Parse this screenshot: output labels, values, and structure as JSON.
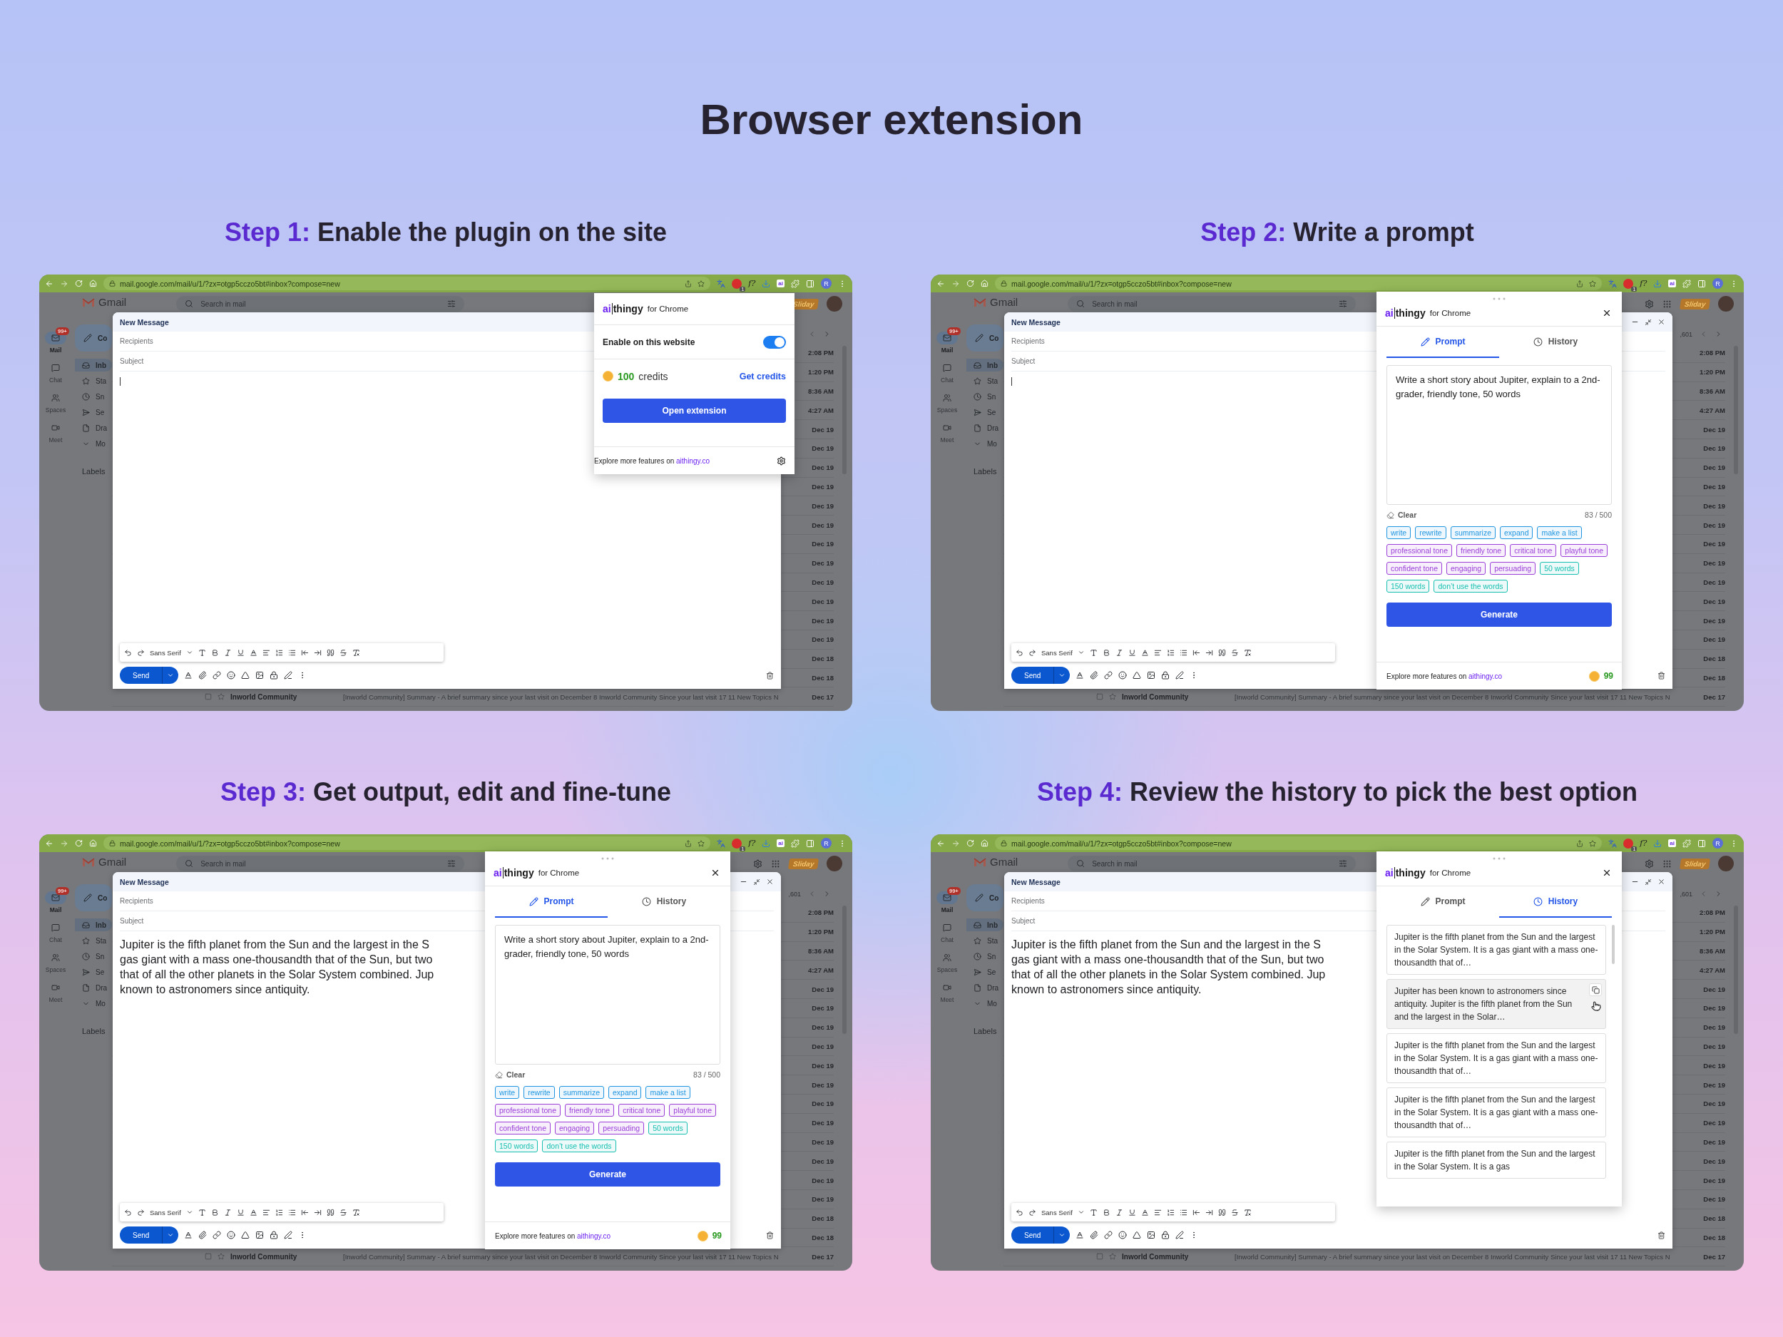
{
  "title": "Browser extension",
  "steps": [
    {
      "step": "Step 1:",
      "heading": "Enable the plugin on the site",
      "browser": {
        "url": "mail.google.com/mail/u/1/?zx=otgp5cczo5bt#inbox?compose=new",
        "ext_text": "f?",
        "ext_badge": "1",
        "ext_ai": "ai",
        "profile": "R"
      },
      "gmail": {
        "logo": "Gmail",
        "search": "Search in mail",
        "mail_badge": "99+",
        "badge": "Sliday",
        "compose_label": "Co",
        "labels": "Labels",
        "rail": [
          {
            "label": "Mail",
            "kind": "mail",
            "selected": true
          },
          {
            "label": "Chat",
            "kind": "chat",
            "selected": false
          },
          {
            "label": "Spaces",
            "kind": "spaces",
            "selected": false
          },
          {
            "label": "Meet",
            "kind": "meet",
            "selected": false
          }
        ],
        "nav": [
          {
            "label": "Inb",
            "kind": "inbox",
            "selected": true
          },
          {
            "label": "Sta",
            "kind": "star",
            "selected": false
          },
          {
            "label": "Sn",
            "kind": "clock",
            "selected": false
          },
          {
            "label": "Se",
            "kind": "send",
            "selected": false
          },
          {
            "label": "Dra",
            "kind": "file",
            "selected": false
          },
          {
            "label": "Mo",
            "kind": "more",
            "selected": false
          }
        ],
        "rows": [
          {
            "date": "2:08 PM"
          },
          {
            "date": "1:20 PM"
          },
          {
            "date": "8:36 AM"
          },
          {
            "date": "4:27 AM"
          },
          {
            "date": "Dec 19"
          },
          {
            "date": "Dec 19"
          },
          {
            "date": "Dec 19"
          },
          {
            "date": "Dec 19"
          },
          {
            "date": "Dec 19"
          },
          {
            "date": "Dec 19"
          },
          {
            "date": "Dec 19"
          },
          {
            "date": "Dec 19"
          },
          {
            "date": "Dec 19"
          },
          {
            "date": "Dec 19"
          },
          {
            "date": "Dec 19"
          },
          {
            "date": "Dec 19"
          },
          {
            "date": "Dec 18"
          },
          {
            "date": "Dec 18"
          },
          {
            "sender": "Inworld Community",
            "snippet": "[Inworld Community] Summary - A brief summary since your last visit on December 8 Inworld Community Since your last visit 17 11 New Topics N",
            "date": "Dec 17"
          }
        ]
      },
      "compose": {
        "title": "New Message",
        "recipients": "Recipients",
        "subject": "Subject",
        "font": "Sans Serif",
        "send": "Send"
      },
      "popup": {
        "kind": "quick",
        "logo_ai": "ai",
        "logo_name": "thingy",
        "logo_suffix": "for Chrome",
        "enable_label": "Enable on this website",
        "enabled": true,
        "credits_amount": "100",
        "credits_unit": "credits",
        "get_credits": "Get credits",
        "open_button": "Open extension",
        "footer_text": "Explore more features on",
        "footer_link": "aithingy.co"
      }
    },
    {
      "step": "Step 2:",
      "heading": "Write a prompt",
      "browser": {
        "url": "mail.google.com/mail/u/1/?zx=otgp5cczo5bt#inbox?compose=new",
        "ext_text": "f?",
        "ext_badge": "1",
        "ext_ai": "ai",
        "profile": "R"
      },
      "gmail": {
        "logo": "Gmail",
        "search": "Search in mail",
        "mail_badge": "99+",
        "badge": "Sliday",
        "pager_text": ",601",
        "compose_label": "Co",
        "labels": "Labels",
        "rail": [
          {
            "label": "Mail",
            "kind": "mail",
            "selected": true
          },
          {
            "label": "Chat",
            "kind": "chat",
            "selected": false
          },
          {
            "label": "Spaces",
            "kind": "spaces",
            "selected": false
          },
          {
            "label": "Meet",
            "kind": "meet",
            "selected": false
          }
        ],
        "nav": [
          {
            "label": "Inb",
            "kind": "inbox",
            "selected": true
          },
          {
            "label": "Sta",
            "kind": "star",
            "selected": false
          },
          {
            "label": "Sn",
            "kind": "clock",
            "selected": false
          },
          {
            "label": "Se",
            "kind": "send",
            "selected": false
          },
          {
            "label": "Dra",
            "kind": "file",
            "selected": false
          },
          {
            "label": "Mo",
            "kind": "more",
            "selected": false
          }
        ],
        "rows": [
          {
            "date": "2:08 PM"
          },
          {
            "date": "1:20 PM"
          },
          {
            "date": "8:36 AM"
          },
          {
            "date": "4:27 AM"
          },
          {
            "date": "Dec 19"
          },
          {
            "date": "Dec 19"
          },
          {
            "date": "Dec 19"
          },
          {
            "date": "Dec 19"
          },
          {
            "date": "Dec 19"
          },
          {
            "date": "Dec 19"
          },
          {
            "date": "Dec 19"
          },
          {
            "date": "Dec 19"
          },
          {
            "date": "Dec 19"
          },
          {
            "date": "Dec 19"
          },
          {
            "date": "Dec 19"
          },
          {
            "date": "Dec 19"
          },
          {
            "date": "Dec 18"
          },
          {
            "date": "Dec 18"
          },
          {
            "sender": "Inworld Community",
            "snippet": "[Inworld Community] Summary - A brief summary since your last visit on December 8 Inworld Community Since your last visit 17 11 New Topics N",
            "date": "Dec 17"
          }
        ]
      },
      "compose": {
        "title": "New Message",
        "recipients": "Recipients",
        "subject": "Subject",
        "font": "Sans Serif",
        "send": "Send"
      },
      "popup": {
        "kind": "prompt",
        "logo_ai": "ai",
        "logo_name": "thingy",
        "logo_suffix": "for Chrome",
        "tabs": [
          {
            "label": "Prompt",
            "kind": "edit",
            "selected": true
          },
          {
            "label": "History",
            "kind": "history",
            "selected": false
          }
        ],
        "prompt": "Write a short story about Jupiter, explain to a 2nd-grader, friendly tone, 50 words",
        "clear": "Clear",
        "counter": "83 / 500",
        "chips": [
          {
            "label": "write",
            "color": "#2196e0"
          },
          {
            "label": "rewrite",
            "color": "#2196e0"
          },
          {
            "label": "summarize",
            "color": "#2196e0"
          },
          {
            "label": "expand",
            "color": "#2196e0"
          },
          {
            "label": "make a list",
            "color": "#2196e0"
          },
          {
            "label": "professional tone",
            "color": "#9b3fd8"
          },
          {
            "label": "friendly tone",
            "color": "#9b3fd8"
          },
          {
            "label": "critical tone",
            "color": "#9b3fd8"
          },
          {
            "label": "playful tone",
            "color": "#9b3fd8"
          },
          {
            "label": "confident tone",
            "color": "#9b3fd8"
          },
          {
            "label": "engaging",
            "color": "#9b3fd8"
          },
          {
            "label": "persuading",
            "color": "#9b3fd8"
          },
          {
            "label": "50 words",
            "color": "#17bfb0"
          },
          {
            "label": "150 words",
            "color": "#17bfb0"
          },
          {
            "label": "don’t use the words",
            "color": "#17bfb0"
          }
        ],
        "generate": "Generate",
        "footer_text": "Explore more features on",
        "footer_link": "aithingy.co",
        "credits": "99"
      }
    },
    {
      "step": "Step 3:",
      "heading": "Get output, edit and fine-tune",
      "browser": {
        "url": "mail.google.com/mail/u/1/?zx=otgp5cczo5bt#inbox?compose=new",
        "ext_text": "f?",
        "ext_badge": "1",
        "ext_ai": "ai",
        "profile": "R"
      },
      "gmail": {
        "logo": "Gmail",
        "search": "Search in mail",
        "mail_badge": "99+",
        "badge": "Sliday",
        "pager_text": ",601",
        "compose_label": "Co",
        "labels": "Labels",
        "rail": [
          {
            "label": "Mail",
            "kind": "mail",
            "selected": true
          },
          {
            "label": "Chat",
            "kind": "chat",
            "selected": false
          },
          {
            "label": "Spaces",
            "kind": "spaces",
            "selected": false
          },
          {
            "label": "Meet",
            "kind": "meet",
            "selected": false
          }
        ],
        "nav": [
          {
            "label": "Inb",
            "kind": "inbox",
            "selected": true
          },
          {
            "label": "Sta",
            "kind": "star",
            "selected": false
          },
          {
            "label": "Sn",
            "kind": "clock",
            "selected": false
          },
          {
            "label": "Se",
            "kind": "send",
            "selected": false
          },
          {
            "label": "Dra",
            "kind": "file",
            "selected": false
          },
          {
            "label": "Mo",
            "kind": "more",
            "selected": false
          }
        ],
        "rows": [
          {
            "date": "2:08 PM"
          },
          {
            "date": "1:20 PM"
          },
          {
            "date": "8:36 AM"
          },
          {
            "date": "4:27 AM"
          },
          {
            "date": "Dec 19"
          },
          {
            "date": "Dec 19"
          },
          {
            "date": "Dec 19"
          },
          {
            "date": "Dec 19"
          },
          {
            "date": "Dec 19"
          },
          {
            "date": "Dec 19"
          },
          {
            "date": "Dec 19"
          },
          {
            "date": "Dec 19"
          },
          {
            "date": "Dec 19"
          },
          {
            "date": "Dec 19"
          },
          {
            "date": "Dec 19"
          },
          {
            "date": "Dec 19"
          },
          {
            "date": "Dec 18"
          },
          {
            "date": "Dec 18"
          },
          {
            "sender": "Inworld Community",
            "snippet": "[Inworld Community] Summary - A brief summary since your last visit on December 8 Inworld Community Since your last visit 17 11 New Topics N",
            "date": "Dec 17"
          }
        ]
      },
      "compose": {
        "title": "New Message",
        "recipients": "Recipients",
        "subject": "Subject",
        "font": "Sans Serif",
        "send": "Send",
        "body_lines": [
          "Jupiter is the fifth planet from the Sun and the largest in the S",
          "gas giant with a mass one-thousandth that of the Sun, but two",
          "that of all the other planets in the Solar System combined. Jup",
          "known to astronomers since antiquity."
        ]
      },
      "popup": {
        "kind": "prompt",
        "logo_ai": "ai",
        "logo_name": "thingy",
        "logo_suffix": "for Chrome",
        "tabs": [
          {
            "label": "Prompt",
            "kind": "edit",
            "selected": true
          },
          {
            "label": "History",
            "kind": "history",
            "selected": false
          }
        ],
        "prompt": "Write a short story about Jupiter, explain to a 2nd-grader, friendly tone, 50 words",
        "clear": "Clear",
        "counter": "83 / 500",
        "chips": [
          {
            "label": "write",
            "color": "#2196e0"
          },
          {
            "label": "rewrite",
            "color": "#2196e0"
          },
          {
            "label": "summarize",
            "color": "#2196e0"
          },
          {
            "label": "expand",
            "color": "#2196e0"
          },
          {
            "label": "make a list",
            "color": "#2196e0"
          },
          {
            "label": "professional tone",
            "color": "#9b3fd8"
          },
          {
            "label": "friendly tone",
            "color": "#9b3fd8"
          },
          {
            "label": "critical tone",
            "color": "#9b3fd8"
          },
          {
            "label": "playful tone",
            "color": "#9b3fd8"
          },
          {
            "label": "confident tone",
            "color": "#9b3fd8"
          },
          {
            "label": "engaging",
            "color": "#9b3fd8"
          },
          {
            "label": "persuading",
            "color": "#9b3fd8"
          },
          {
            "label": "50 words",
            "color": "#17bfb0"
          },
          {
            "label": "150 words",
            "color": "#17bfb0"
          },
          {
            "label": "don’t use the words",
            "color": "#17bfb0"
          }
        ],
        "generate": "Generate",
        "footer_text": "Explore more features on",
        "footer_link": "aithingy.co",
        "credits": "99"
      }
    },
    {
      "step": "Step 4:",
      "heading": "Review the history to pick the best option",
      "browser": {
        "url": "mail.google.com/mail/u/1/?zx=otgp5cczo5bt#inbox?compose=new",
        "ext_text": "f?",
        "ext_badge": "1",
        "ext_ai": "ai",
        "profile": "R"
      },
      "gmail": {
        "logo": "Gmail",
        "search": "Search in mail",
        "mail_badge": "99+",
        "badge": "Sliday",
        "pager_text": ",601",
        "compose_label": "Co",
        "labels": "Labels",
        "rail": [
          {
            "label": "Mail",
            "kind": "mail",
            "selected": true
          },
          {
            "label": "Chat",
            "kind": "chat",
            "selected": false
          },
          {
            "label": "Spaces",
            "kind": "spaces",
            "selected": false
          },
          {
            "label": "Meet",
            "kind": "meet",
            "selected": false
          }
        ],
        "nav": [
          {
            "label": "Inb",
            "kind": "inbox",
            "selected": true
          },
          {
            "label": "Sta",
            "kind": "star",
            "selected": false
          },
          {
            "label": "Sn",
            "kind": "clock",
            "selected": false
          },
          {
            "label": "Se",
            "kind": "send",
            "selected": false
          },
          {
            "label": "Dra",
            "kind": "file",
            "selected": false
          },
          {
            "label": "Mo",
            "kind": "more",
            "selected": false
          }
        ],
        "rows": [
          {
            "date": "2:08 PM"
          },
          {
            "date": "1:20 PM"
          },
          {
            "date": "8:36 AM"
          },
          {
            "date": "4:27 AM"
          },
          {
            "date": "Dec 19"
          },
          {
            "date": "Dec 19"
          },
          {
            "date": "Dec 19"
          },
          {
            "date": "Dec 19"
          },
          {
            "date": "Dec 19"
          },
          {
            "date": "Dec 19"
          },
          {
            "date": "Dec 19"
          },
          {
            "date": "Dec 19"
          },
          {
            "date": "Dec 19"
          },
          {
            "date": "Dec 19"
          },
          {
            "date": "Dec 19"
          },
          {
            "date": "Dec 19"
          },
          {
            "date": "Dec 18"
          },
          {
            "date": "Dec 18"
          },
          {
            "sender": "Inworld Community",
            "snippet": "[Inworld Community] Summary - A brief summary since your last visit on December 8 Inworld Community Since your last visit 17 11 New Topics N",
            "date": "Dec 17"
          }
        ]
      },
      "compose": {
        "title": "New Message",
        "recipients": "Recipients",
        "subject": "Subject",
        "font": "Sans Serif",
        "send": "Send",
        "body_lines": [
          "Jupiter is the fifth planet from the Sun and the largest in the S",
          "gas giant with a mass one-thousandth that of the Sun, but two",
          "that of all the other planets in the Solar System combined. Jup",
          "known to astronomers since antiquity."
        ]
      },
      "popup": {
        "kind": "history",
        "logo_ai": "ai",
        "logo_name": "thingy",
        "logo_suffix": "for Chrome",
        "tabs": [
          {
            "label": "Prompt",
            "kind": "edit",
            "selected": false
          },
          {
            "label": "History",
            "kind": "history",
            "selected": true
          }
        ],
        "history": [
          {
            "text": "Jupiter is the fifth planet from the Sun and the largest in the Solar System. It is a gas giant with a mass one-thousandth that of…",
            "hovered": false
          },
          {
            "text": "Jupiter has been known to astronomers since antiquity. Jupiter is the fifth planet from the Sun and the largest in the Solar…",
            "hovered": true
          },
          {
            "text": "Jupiter is the fifth planet from the Sun and the largest in the Solar System. It is a gas giant with a mass one-thousandth that of…",
            "hovered": false
          },
          {
            "text": "Jupiter is the fifth planet from the Sun and the largest in the Solar System. It is a gas giant with a mass one-thousandth that of…",
            "hovered": false
          },
          {
            "text": "Jupiter is the fifth planet from the Sun and the largest in the Solar System. It is a gas",
            "hovered": false
          }
        ]
      }
    }
  ]
}
